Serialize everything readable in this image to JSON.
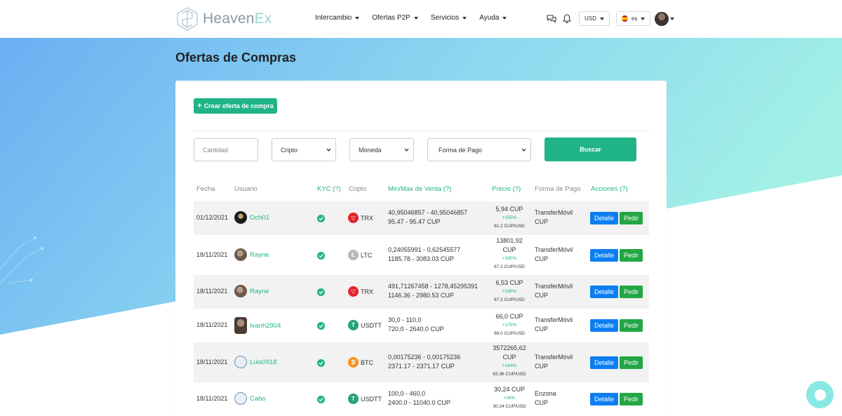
{
  "brand": {
    "name_part1": "Heaven",
    "name_part2": "Ex"
  },
  "nav": {
    "items": [
      {
        "label": "Intercambio"
      },
      {
        "label": "Ofertas P2P"
      },
      {
        "label": "Servicios"
      },
      {
        "label": "Ayuda"
      }
    ],
    "currency": "USD",
    "language": "es"
  },
  "page": {
    "title": "Ofertas de Compras"
  },
  "actions": {
    "create_label": "Crear oferta de compra",
    "search_label": "Buscar"
  },
  "filters": {
    "quantity_placeholder": "Cantidad",
    "crypto": "Cripto",
    "currency": "Moneda",
    "payment": "Forma de Pago"
  },
  "table": {
    "headers": [
      "Fecha",
      "Usuario",
      "KYC (?)",
      "Cripto",
      "Min/Max de Venta (?)",
      "Precio (?)",
      "Forma de Pago",
      "Acciones (?)"
    ],
    "detail_label": "Detalle",
    "order_label": "Pedir",
    "rows": [
      {
        "date": "01/12/2021",
        "user": "Och01",
        "coin": "TRX",
        "range1": "40,95046857 - 40,95046857",
        "range2": "95.47 - 95.47 CUP",
        "price": "5,94 CUP",
        "pct": "+155%",
        "rate": "61.2 CUP/USD",
        "pay1": "TransferMóvil",
        "pay2": "CUP"
      },
      {
        "date": "18/11/2021",
        "user": "Rayne",
        "coin": "LTC",
        "range1": "0,24055991 - 0,62545577",
        "range2": "1185.78 - 3083.03 CUP",
        "price": "13801,92 CUP",
        "pct": "+180%",
        "rate": "67.2 CUP/USD",
        "pay1": "TransferMóvil",
        "pay2": "CUP"
      },
      {
        "date": "18/11/2021",
        "user": "Rayne",
        "coin": "TRX",
        "range1": "491,71267458 - 1278,45295391",
        "range2": "1146.36 - 2980.53 CUP",
        "price": "6,53 CUP",
        "pct": "+180%",
        "rate": "67.2 CUP/USD",
        "pay1": "TransferMóvil",
        "pay2": "CUP"
      },
      {
        "date": "18/11/2021",
        "user": "Ivanh2904",
        "coin": "USDTT",
        "range1": "30,0 - 110,0",
        "range2": "720.0 - 2640.0 CUP",
        "price": "66,0 CUP",
        "pct": "+175%",
        "rate": "66.0 CUP/USD",
        "pay1": "TransferMóvil",
        "pay2": "CUP"
      },
      {
        "date": "18/11/2021",
        "user": "Luis0918",
        "coin": "BTC",
        "range1": "0,00175236 - 0,00175236",
        "range2": "2371.17 - 2371.17 CUP",
        "price": "3572265,62 CUP",
        "pct": "+164%",
        "rate": "63.36 CUP/USD",
        "pay1": "TransferMóvil",
        "pay2": "CUP"
      },
      {
        "date": "18/11/2021",
        "user": "Cabo",
        "coin": "USDTT",
        "range1": "100,0 - 460,0",
        "range2": "2400.0 - 11040.0 CUP",
        "price": "30,24 CUP",
        "pct": "+26%",
        "rate": "30.24 CUP/USD",
        "pay1": "Enzona",
        "pay2": "CUP"
      }
    ]
  },
  "colors": {
    "accent": "#20b486",
    "detail": "#0d7ef1",
    "order": "#22a744"
  },
  "icons": {
    "chat": "chat-icon",
    "bell": "bell-icon",
    "support": "support-chat-icon"
  }
}
